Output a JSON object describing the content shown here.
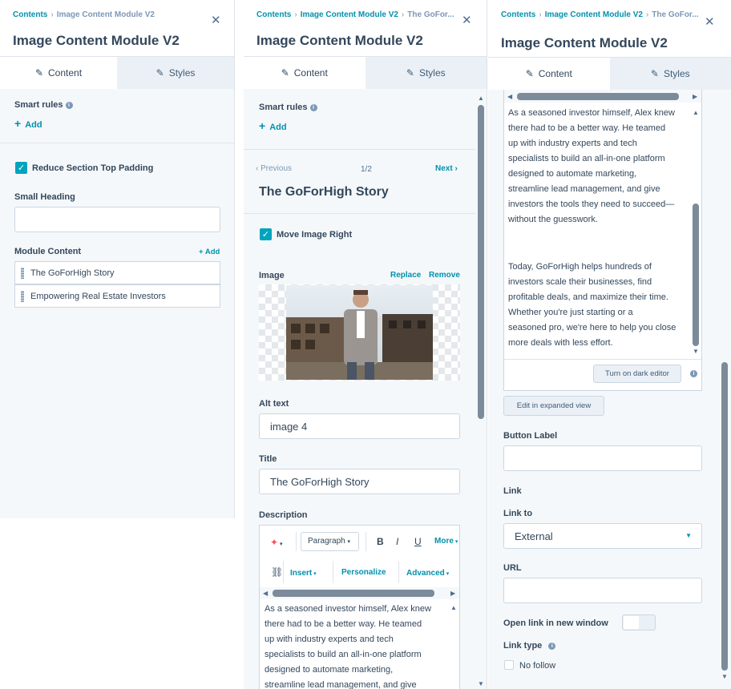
{
  "panel1": {
    "breadcrumb": [
      "Contents",
      "Image Content Module V2"
    ],
    "title": "Image Content Module V2",
    "tabs": [
      "Content",
      "Styles"
    ],
    "smart_rules_label": "Smart rules",
    "add_label": "Add",
    "reduce_padding_label": "Reduce Section Top Padding",
    "reduce_padding_checked": true,
    "small_heading_label": "Small Heading",
    "small_heading_value": "",
    "module_content_label": "Module Content",
    "module_add_label": "+ Add",
    "module_items": [
      "The GoForHigh Story",
      "Empowering Real Estate Investors"
    ]
  },
  "panel2": {
    "breadcrumb": [
      "Contents",
      "Image Content Module V2",
      "The GoFor..."
    ],
    "title": "Image Content Module V2",
    "tabs": [
      "Content",
      "Styles"
    ],
    "smart_rules_label": "Smart rules",
    "add_label": "Add",
    "previous_label": "Previous",
    "pagination": "1/2",
    "next_label": "Next",
    "item_title": "The GoForHigh Story",
    "move_image_label": "Move Image Right",
    "move_image_checked": true,
    "image_label": "Image",
    "replace_label": "Replace",
    "remove_label": "Remove",
    "alt_text_label": "Alt text",
    "alt_text_value": "image 4",
    "title_label": "Title",
    "title_value": "The GoForHigh Story",
    "description_label": "Description",
    "toolbar": {
      "paragraph": "Paragraph",
      "bold": "B",
      "italic": "I",
      "underline": "U",
      "more": "More",
      "insert": "Insert",
      "personalize": "Personalize",
      "advanced": "Advanced"
    },
    "description_lines": [
      "As a seasoned investor himself, Alex knew",
      "there had to be a better way. He teamed",
      "up with industry experts and tech",
      "specialists to build an all-in-one platform",
      "designed to automate marketing,",
      "streamline lead management, and give"
    ]
  },
  "panel3": {
    "breadcrumb": [
      "Contents",
      "Image Content Module V2",
      "The GoFor..."
    ],
    "title": "Image Content Module V2",
    "tabs": [
      "Content",
      "Styles"
    ],
    "rte_lines_1": [
      "As a seasoned investor himself, Alex knew",
      "there had to be a better way. He teamed",
      "up with industry experts and tech",
      "specialists to build an all-in-one platform",
      "designed to automate marketing,",
      "streamline lead management, and give",
      "investors the tools they need to succeed—",
      "without the guesswork."
    ],
    "rte_lines_2": [
      "Today, GoForHigh helps hundreds of",
      "investors scale their businesses, find",
      "profitable deals, and maximize their time.",
      "Whether you're just starting or a",
      "seasoned pro, we're here to help you close",
      "more deals with less effort."
    ],
    "dark_editor_label": "Turn on dark editor",
    "expanded_view_label": "Edit in expanded view",
    "button_label_label": "Button Label",
    "button_label_value": "",
    "link_label": "Link",
    "link_to_label": "Link to",
    "link_to_value": "External",
    "url_label": "URL",
    "url_value": "",
    "new_window_label": "Open link in new window",
    "link_type_label": "Link type",
    "no_follow_label": "No follow"
  },
  "colors": {
    "accent": "#0091ae",
    "checkbox": "#00a4bd",
    "text": "#33475b",
    "panel_bg": "#f5f8fa",
    "tab_inactive": "#eaf0f6"
  }
}
